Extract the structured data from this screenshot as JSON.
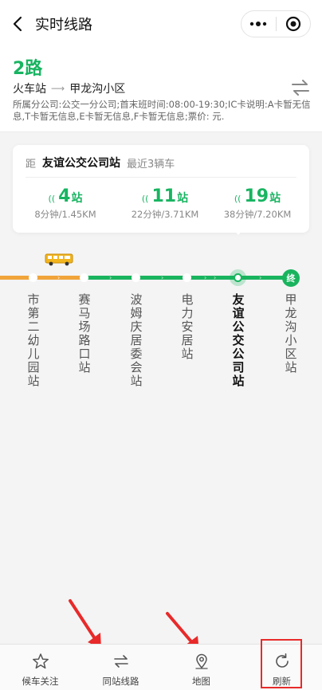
{
  "nav": {
    "title": "实时线路",
    "back_icon": "chevron-left-icon",
    "more_icon": "more-dots-icon",
    "close_icon": "target-circle-icon"
  },
  "route": {
    "name": "2路",
    "from": "火车站",
    "arrow": "⟶",
    "to": "甲龙沟小区",
    "description": "所属分公司:公交一分公司;首末班时间:08:00-19:30;IC卡说明:A卡暂无信息,T卡暂无信息,E卡暂无信息,F卡暂无信息;票价:  元."
  },
  "card": {
    "prefix": "距",
    "station": "友谊公交公司站",
    "recent": "最近3辆车",
    "buses": [
      {
        "num": "4",
        "unit": "站",
        "detail": "8分钟/1.45KM"
      },
      {
        "num": "11",
        "unit": "站",
        "detail": "22分钟/3.71KM"
      },
      {
        "num": "19",
        "unit": "站",
        "detail": "38分钟/7.20KM"
      }
    ]
  },
  "line": {
    "end_label": "终"
  },
  "stops": [
    {
      "name": "市第二幼儿园站"
    },
    {
      "name": "赛马场路口站"
    },
    {
      "name": "波姆庆居委会站"
    },
    {
      "name": "电力安居站"
    },
    {
      "name": "友谊公交公司站"
    },
    {
      "name": "甲龙沟小区站"
    }
  ],
  "tabs": [
    {
      "label": "候车关注",
      "icon": "star-icon"
    },
    {
      "label": "同站线路",
      "icon": "transfer-icon"
    },
    {
      "label": "地图",
      "icon": "map-pin-icon"
    },
    {
      "label": "刷新",
      "icon": "refresh-icon"
    }
  ],
  "colors": {
    "accent": "#19b45e",
    "passed": "#f0a43a",
    "annotation": "#e82a2a"
  }
}
